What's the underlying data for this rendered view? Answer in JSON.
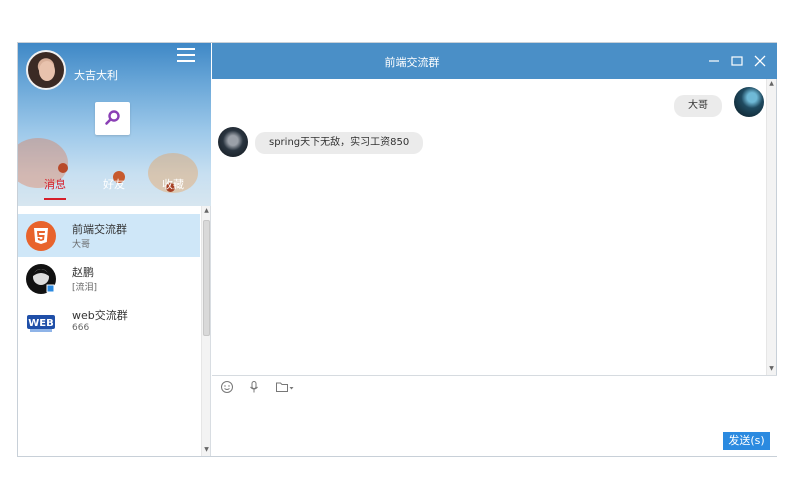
{
  "user": {
    "name": "大吉大利"
  },
  "tabs": [
    {
      "label": "消息",
      "active": true
    },
    {
      "label": "好友",
      "active": false
    },
    {
      "label": "收藏",
      "active": false
    }
  ],
  "conversations": [
    {
      "name": "前端交流群",
      "last": "大哥",
      "icon": "html5-icon",
      "active": true
    },
    {
      "name": "赵鹏",
      "last": "[流泪]",
      "icon": "user-avatar-icon",
      "active": false
    },
    {
      "name": "web交流群",
      "last": "666",
      "icon": "web-icon",
      "active": false
    }
  ],
  "chat": {
    "title": "前端交流群",
    "messages": [
      {
        "side": "right",
        "text": "大哥"
      },
      {
        "side": "left",
        "text": "spring天下无敌，实习工资850"
      }
    ]
  },
  "composer": {
    "tools": [
      "emoji-icon",
      "microphone-icon",
      "folder-icon"
    ],
    "send_label": "发送(s)"
  },
  "colors": {
    "titlebar": "#4a8fc7",
    "active_tab": "#d61f2b",
    "send_button": "#2b8ae0",
    "active_row": "#cfe7f8"
  }
}
